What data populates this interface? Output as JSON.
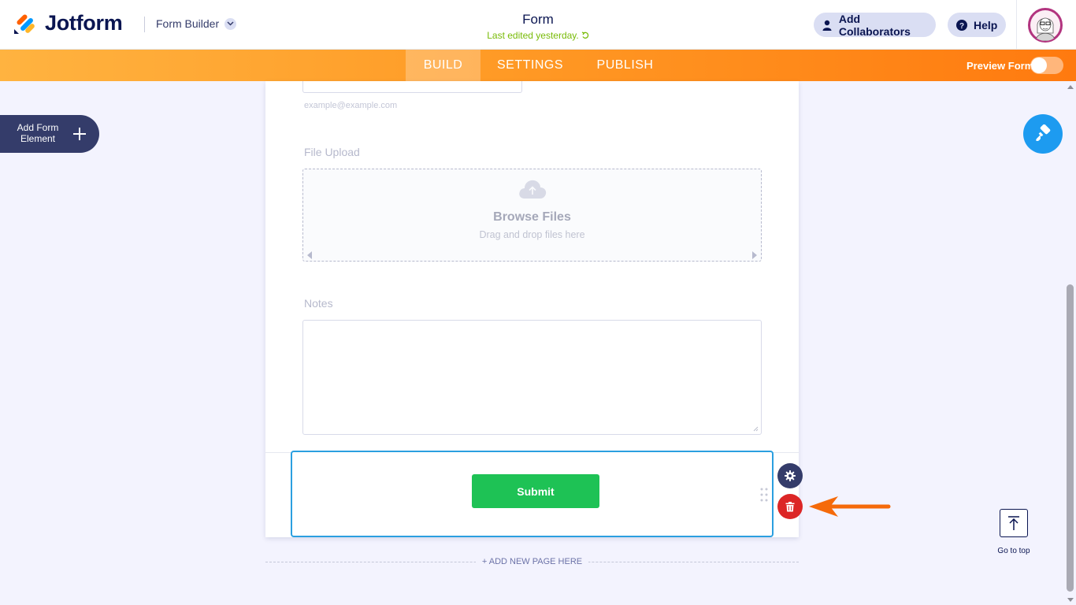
{
  "header": {
    "brand": "Jotform",
    "builder_switch": "Form Builder",
    "form_title": "Form",
    "last_edited": "Last edited yesterday.",
    "add_collaborators": "Add Collaborators",
    "help": "Help"
  },
  "nav": {
    "tabs": [
      {
        "label": "BUILD",
        "active": true
      },
      {
        "label": "SETTINGS",
        "active": false
      },
      {
        "label": "PUBLISH",
        "active": false
      }
    ],
    "preview_form": "Preview Form",
    "preview_enabled": false
  },
  "sidebar": {
    "add_element_label": "Add Form Element"
  },
  "form": {
    "email_sublabel": "example@example.com",
    "file_upload": {
      "label": "File Upload",
      "browse": "Browse Files",
      "hint": "Drag and drop files here"
    },
    "notes": {
      "label": "Notes",
      "value": ""
    },
    "submit_label": "Submit",
    "add_page": "+ ADD NEW PAGE HERE"
  },
  "right": {
    "go_to_top": "Go to top"
  },
  "colors": {
    "brand_navy": "#0a1551",
    "nav_orange_start": "#ffb340",
    "nav_orange_end": "#ff7a0f",
    "submit_green": "#1ec255",
    "selection_blue": "#2b9fe0",
    "delete_red": "#dc2626",
    "annotation_arrow": "#f56a0a",
    "last_edited_green": "#78bb07"
  },
  "icons": {
    "logo": "jotform-logo-icon",
    "collaborators": "user-icon",
    "help": "question-circle-icon",
    "add_element": "plus-icon",
    "designer": "paint-roller-icon",
    "upload": "cloud-upload-icon",
    "settings": "gear-icon",
    "delete": "trash-icon",
    "go_top": "arrow-up-to-line-icon"
  }
}
